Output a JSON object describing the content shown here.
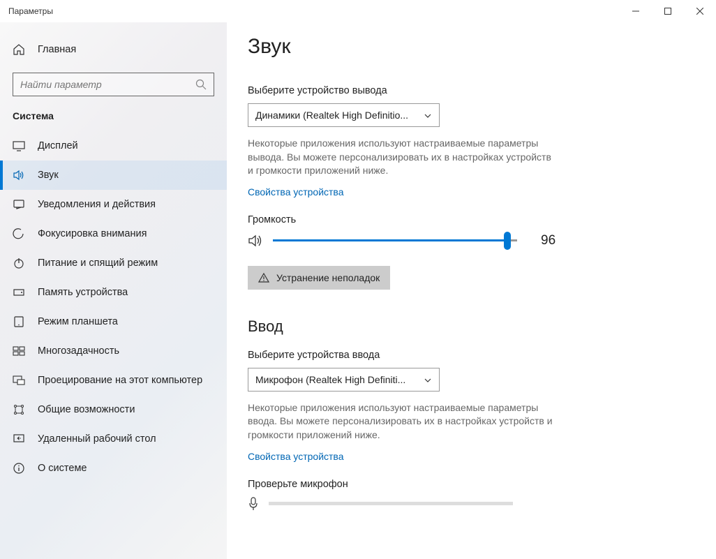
{
  "window": {
    "title": "Параметры"
  },
  "sidebar": {
    "home": "Главная",
    "search_placeholder": "Найти параметр",
    "category": "Система",
    "items": [
      {
        "label": "Дисплей"
      },
      {
        "label": "Звук"
      },
      {
        "label": "Уведомления и действия"
      },
      {
        "label": "Фокусировка внимания"
      },
      {
        "label": "Питание и спящий режим"
      },
      {
        "label": "Память устройства"
      },
      {
        "label": "Режим планшета"
      },
      {
        "label": "Многозадачность"
      },
      {
        "label": "Проецирование на этот компьютер"
      },
      {
        "label": "Общие возможности"
      },
      {
        "label": "Удаленный рабочий стол"
      },
      {
        "label": "О системе"
      }
    ]
  },
  "main": {
    "title": "Звук",
    "output": {
      "label": "Выберите устройство вывода",
      "selected": "Динамики (Realtek High Definitio...",
      "desc": "Некоторые приложения используют настраиваемые параметры вывода. Вы можете персонализировать их в настройках устройств и громкости приложений ниже.",
      "props_link": "Свойства устройства",
      "volume_label": "Громкость",
      "volume_value": "96",
      "troubleshoot": "Устранение неполадок"
    },
    "input": {
      "heading": "Ввод",
      "label": "Выберите устройства ввода",
      "selected": "Микрофон (Realtek High Definiti...",
      "desc": "Некоторые приложения используют настраиваемые параметры ввода. Вы можете персонализировать их в настройках устройств и громкости приложений ниже.",
      "props_link": "Свойства устройства",
      "test_label": "Проверьте микрофон"
    }
  }
}
